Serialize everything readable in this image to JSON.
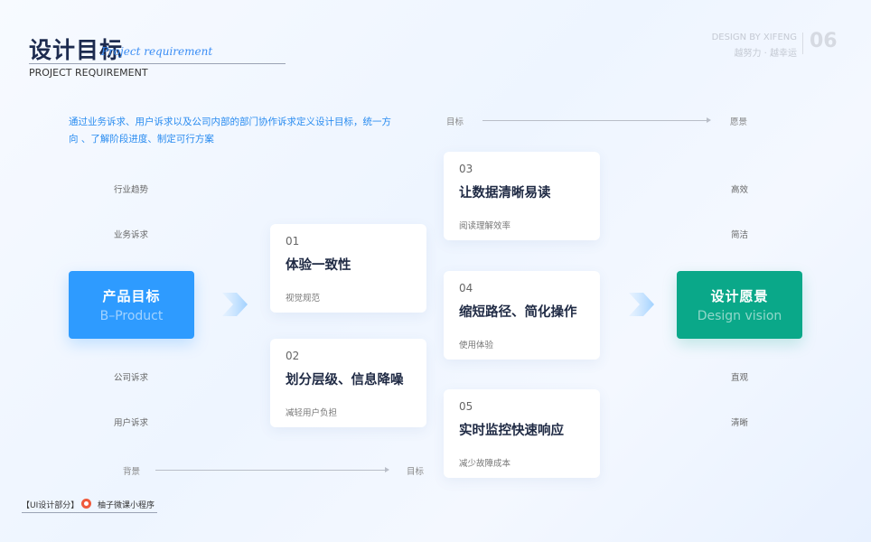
{
  "header": {
    "title_cn": "设计目标",
    "title_script": "Project requirement",
    "title_en": "PROJECT REQUIREMENT",
    "brand_en": "DESIGN BY XIFENG",
    "brand_cn": "越努力 · 越幸运",
    "page_no": "06"
  },
  "intro": "通过业务诉求、用户诉求以及公司内部的部门协作诉求定义设计目标，统一方向 、了解阶段进度、制定可行方案",
  "top_axis": {
    "from": "目标",
    "to": "愿景"
  },
  "bottom_axis": {
    "from": "背景",
    "to": "目标"
  },
  "left_labels": {
    "top": [
      "行业趋势",
      "业务诉求"
    ],
    "bottom": [
      "公司诉求",
      "用户诉求"
    ]
  },
  "right_labels": {
    "top": [
      "高效",
      "简洁"
    ],
    "bottom": [
      "直观",
      "清晰"
    ]
  },
  "product_goal": {
    "cn": "产品目标",
    "en": "B–Product"
  },
  "design_vision": {
    "cn": "设计愿景",
    "en": "Design vision"
  },
  "cards": [
    {
      "num": "01",
      "title": "体验一致性",
      "sub": "视觉规范"
    },
    {
      "num": "02",
      "title": "划分层级、信息降噪",
      "sub": "减轻用户负担"
    },
    {
      "num": "03",
      "title": "让数据清晰易读",
      "sub": "阅读理解效率"
    },
    {
      "num": "04",
      "title": "缩短路径、简化操作",
      "sub": "使用体验"
    },
    {
      "num": "05",
      "title": "实时监控快速响应",
      "sub": "减少故障成本"
    }
  ],
  "footer": {
    "section": "【UI设计部分】",
    "mini": "柚子微课小程序"
  },
  "colors": {
    "blue": "#2e9bff",
    "green": "#0aa889",
    "intro": "#2a8cf0"
  }
}
